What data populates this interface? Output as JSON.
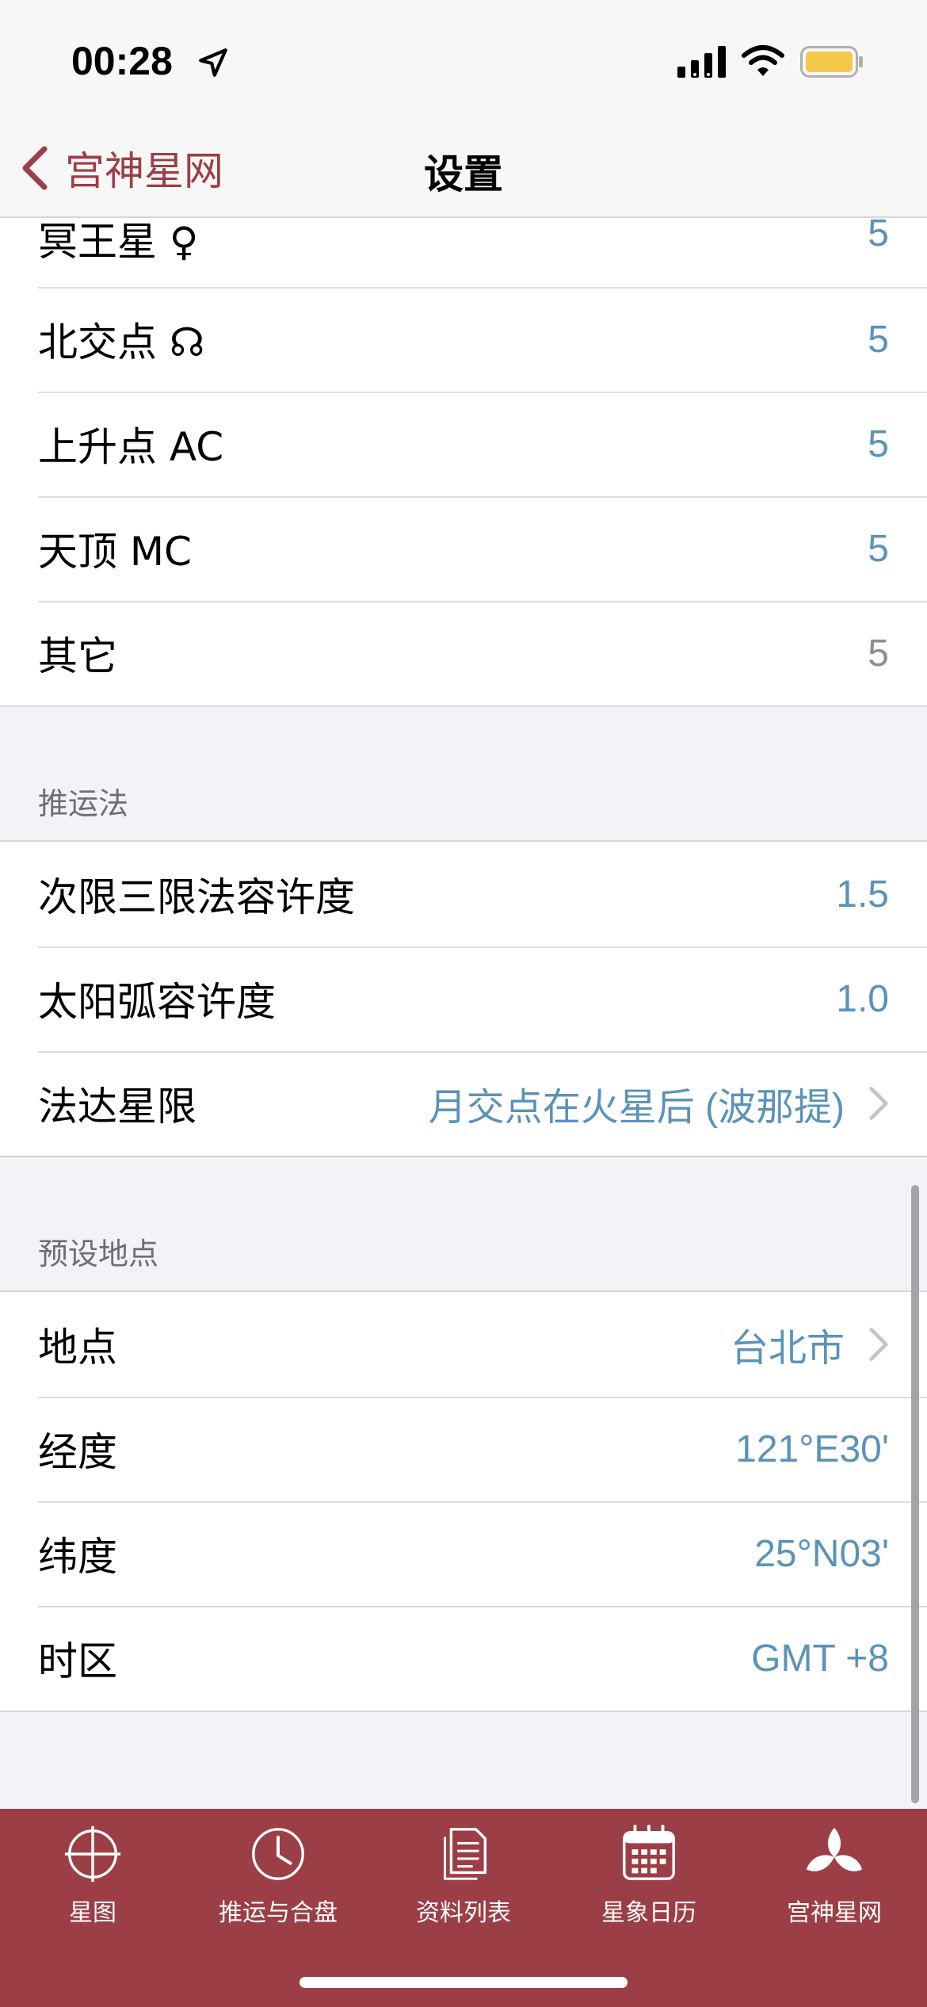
{
  "status": {
    "time": "00:28"
  },
  "nav": {
    "back_label": "宫神星网",
    "title": "设置"
  },
  "group1": [
    {
      "label": "冥王星 ♀",
      "value": "5",
      "grey": false
    },
    {
      "label": "北交点 ☊",
      "value": "5",
      "grey": false
    },
    {
      "label": "上升点 AC",
      "value": "5",
      "grey": false
    },
    {
      "label": "天顶 MC",
      "value": "5",
      "grey": false
    },
    {
      "label": "其它",
      "value": "5",
      "grey": true
    }
  ],
  "section2": {
    "header": "推运法",
    "rows": [
      {
        "label": "次限三限法容许度",
        "value": "1.5"
      },
      {
        "label": "太阳弧容许度",
        "value": "1.0"
      },
      {
        "label": "法达星限",
        "value": "月交点在火星后 (波那提)"
      }
    ]
  },
  "section3": {
    "header": "预设地点",
    "rows": [
      {
        "label": "地点",
        "value": "台北市"
      },
      {
        "label": "经度",
        "value": "121°E30'"
      },
      {
        "label": "纬度",
        "value": "25°N03'"
      },
      {
        "label": "时区",
        "value": "GMT +8"
      }
    ]
  },
  "tabs": [
    {
      "label": "星图",
      "icon": "chart-wheel-icon"
    },
    {
      "label": "推运与合盘",
      "icon": "clock-icon"
    },
    {
      "label": "资料列表",
      "icon": "document-list-icon"
    },
    {
      "label": "星象日历",
      "icon": "calendar-icon"
    },
    {
      "label": "宫神星网",
      "icon": "logo-icon"
    }
  ],
  "colors": {
    "accent": "#9c3e45",
    "value_blue": "#5b93b8",
    "value_grey": "#8e8e93"
  }
}
